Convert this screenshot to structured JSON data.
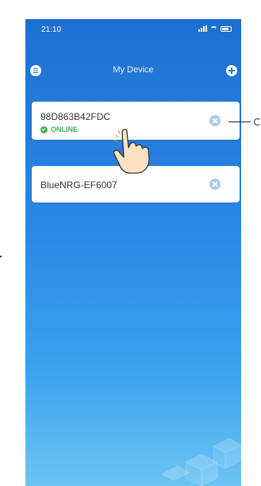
{
  "status_bar": {
    "time": "21:10"
  },
  "header": {
    "title": "My Device"
  },
  "devices": [
    {
      "name": "98D863B42FDC",
      "status": "ONLINE"
    },
    {
      "name": "BlueNRG-EF6007",
      "status": ""
    }
  ],
  "colors": {
    "background_top": "#1e6fd0",
    "background_bottom": "#6dc4f2",
    "online": "#47b04b",
    "remove_icon": "#a9c9ee"
  },
  "icons": [
    "menu-icon",
    "add-icon",
    "remove-icon",
    "check-circle-icon",
    "pointing-hand-icon"
  ]
}
